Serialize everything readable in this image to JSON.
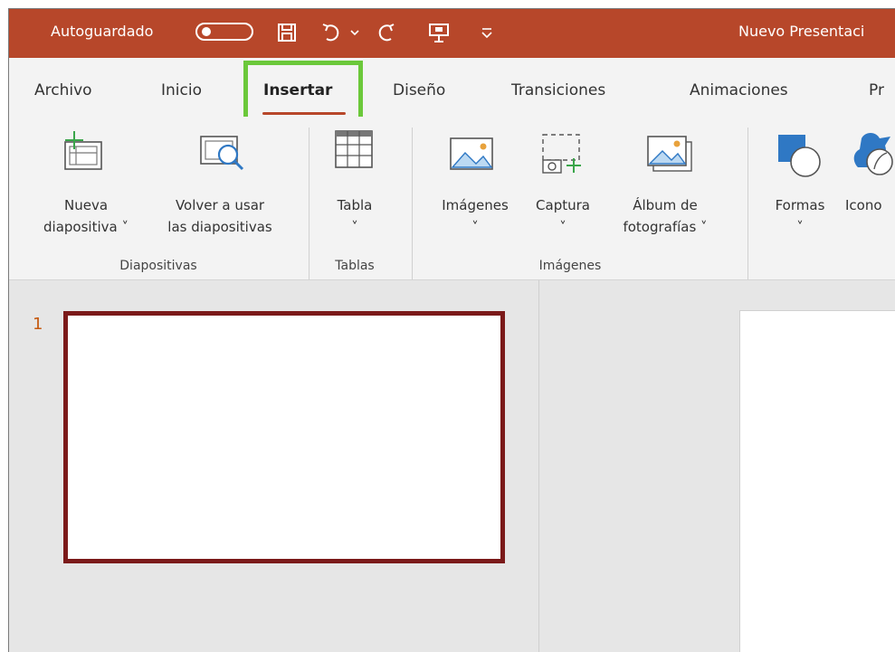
{
  "titlebar": {
    "autosave_label": "Autoguardado",
    "document_title": "Nuevo Presentaci",
    "accent_color": "#b7472a"
  },
  "tabs": [
    {
      "label": "Archivo"
    },
    {
      "label": "Inicio"
    },
    {
      "label": "Insertar",
      "active": true
    },
    {
      "label": "Diseño"
    },
    {
      "label": "Transiciones"
    },
    {
      "label": "Animaciones"
    },
    {
      "label": "Pr"
    }
  ],
  "ribbon": {
    "new_slide": {
      "line1": "Nueva",
      "line2": "diapositiva ˅"
    },
    "reuse_slides": {
      "line1": "Volver a usar",
      "line2": "las diapositivas"
    },
    "table": {
      "line1": "Tabla",
      "line2": "˅"
    },
    "images": {
      "line1": "Imágenes",
      "line2": "˅"
    },
    "screenshot": {
      "line1": "Captura",
      "line2": "˅"
    },
    "photo_album": {
      "line1": "Álbum de",
      "line2": "fotografías ˅"
    },
    "shapes": {
      "line1": "Formas",
      "line2": "˅"
    },
    "icons": {
      "line1": "Icono"
    },
    "groups": {
      "slides": "Diapositivas",
      "tables": "Tablas",
      "images": "Imágenes"
    }
  },
  "slides_pane": {
    "slide_number": "1"
  }
}
